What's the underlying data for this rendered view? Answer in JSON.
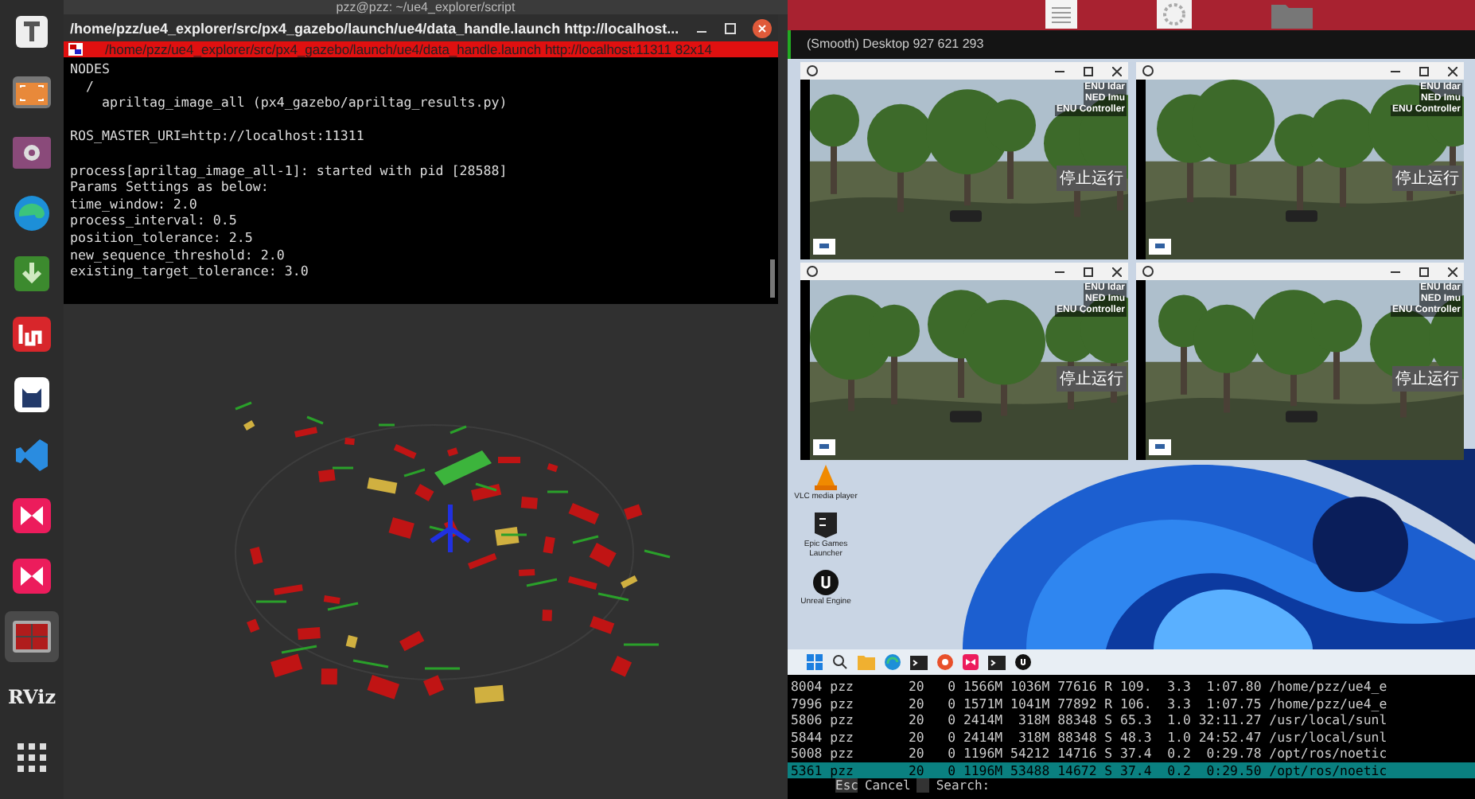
{
  "dock": {
    "items": [
      {
        "kind": "text-editor",
        "active": false
      },
      {
        "kind": "screenshot",
        "active": false
      },
      {
        "kind": "video",
        "active": false
      },
      {
        "kind": "browser",
        "active": false
      },
      {
        "kind": "download",
        "active": false
      },
      {
        "kind": "im",
        "active": false
      },
      {
        "kind": "cat",
        "active": false
      },
      {
        "kind": "code",
        "active": false
      },
      {
        "kind": "player",
        "active": false
      },
      {
        "kind": "player",
        "active": false
      },
      {
        "kind": "remote",
        "active": true
      },
      {
        "kind": "rviz",
        "label": "RViz",
        "active": false
      },
      {
        "kind": "apps",
        "active": false
      }
    ]
  },
  "background_window": {
    "title": "pzz@pzz: ~/ue4_explorer/script"
  },
  "terminal": {
    "title": "/home/pzz/ue4_explorer/src/px4_gazebo/launch/ue4/data_handle.launch http://localhost...",
    "tab_title": "/home/pzz/ue4_explorer/src/px4_gazebo/launch/ue4/data_handle.launch http://localhost:11311 82x14",
    "lines": [
      {
        "text": "NODES",
        "gap_before": false
      },
      {
        "text": "  /",
        "gap_before": false
      },
      {
        "text": "    apriltag_image_all (px4_gazebo/apriltag_results.py)",
        "gap_before": false
      },
      {
        "text": "ROS_MASTER_URI=http://localhost:11311",
        "gap_before": true
      },
      {
        "text": "process[apriltag_image_all-1]: started with pid [28588]",
        "gap_before": true
      },
      {
        "text": "Params Settings as below:",
        "gap_before": false
      },
      {
        "text": "time_window: 2.0",
        "gap_before": false
      },
      {
        "text": "process_interval: 0.5",
        "gap_before": false
      },
      {
        "text": "position_tolerance: 2.5",
        "gap_before": false
      },
      {
        "text": "new_sequence_threshold: 2.0",
        "gap_before": false
      },
      {
        "text": "existing_target_tolerance: 3.0",
        "gap_before": false
      }
    ]
  },
  "remote_viewer": {
    "title": "(Smooth) Desktop 927 621 293"
  },
  "sim_windows": [
    {
      "overlay_lines": [
        "ENU Idar",
        "NED Imu",
        "ENU Controller"
      ],
      "button": "停止运行"
    },
    {
      "overlay_lines": [
        "ENU Idar",
        "NED Imu",
        "ENU Controller"
      ],
      "button": "停止运行"
    },
    {
      "overlay_lines": [
        "ENU Idar",
        "NED Imu",
        "ENU Controller"
      ],
      "button": "停止运行"
    },
    {
      "overlay_lines": [
        "ENU Idar",
        "NED Imu",
        "ENU Controller"
      ],
      "button": "停止运行"
    }
  ],
  "desktop_icons": [
    {
      "kind": "cone",
      "label": "VLC media player"
    },
    {
      "kind": "epic",
      "label": "Epic Games Launcher"
    },
    {
      "kind": "unreal",
      "label": "Unreal Engine"
    }
  ],
  "taskbar": {
    "items": [
      {
        "kind": "start"
      },
      {
        "kind": "search"
      },
      {
        "kind": "folder"
      },
      {
        "kind": "browser"
      },
      {
        "kind": "terminal"
      },
      {
        "kind": "chrome"
      },
      {
        "kind": "player"
      },
      {
        "kind": "terminal"
      },
      {
        "kind": "unreal"
      }
    ]
  },
  "htop": {
    "rows": [
      {
        "text": "8004 pzz       20   0 1566M 1036M 77616 R 109.  3.3  1:07.80 /home/pzz/ue4_e",
        "selected": false
      },
      {
        "text": "7996 pzz       20   0 1571M 1041M 77892 R 106.  3.3  1:07.75 /home/pzz/ue4_e",
        "selected": false
      },
      {
        "text": "5806 pzz       20   0 2414M  318M 88348 S 65.3  1.0 32:11.27 /usr/local/sunl",
        "selected": false
      },
      {
        "text": "5844 pzz       20   0 2414M  318M 88348 S 48.3  1.0 24:52.47 /usr/local/sunl",
        "selected": false
      },
      {
        "text": "5008 pzz       20   0 1196M 54212 14716 S 37.4  0.2  0:29.78 /opt/ros/noetic",
        "selected": false
      },
      {
        "text": "5361 pzz       20   0 1196M 53488 14672 S 37.4  0.2  0:29.50 /opt/ros/noetic",
        "selected": true
      }
    ],
    "footer": {
      "key": "Esc",
      "action": "Cancel",
      "prompt": "Search:"
    }
  }
}
